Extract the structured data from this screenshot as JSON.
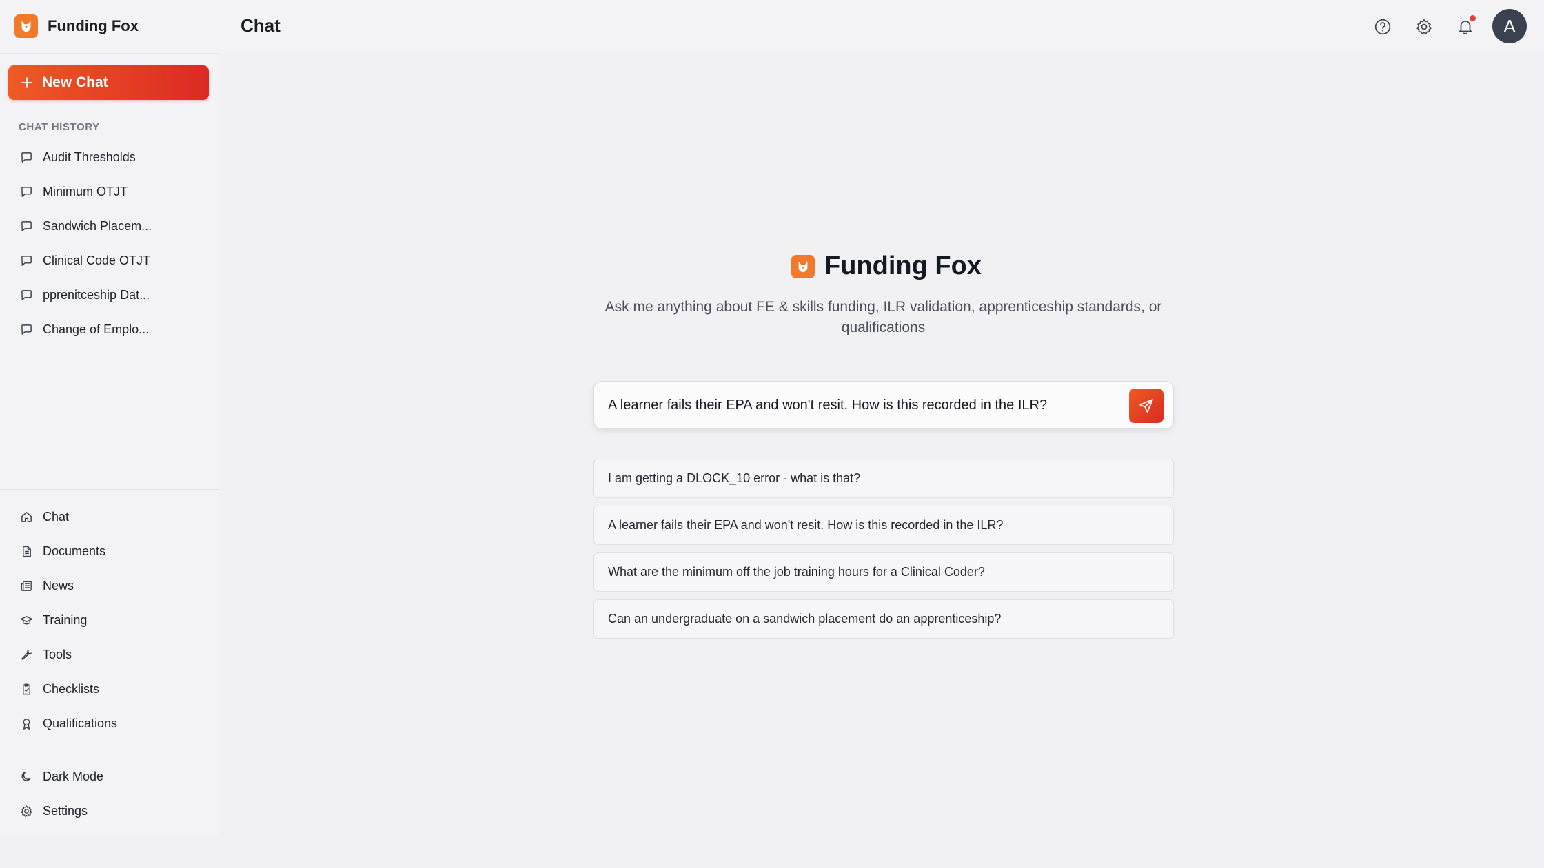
{
  "app": {
    "name": "Funding Fox",
    "logo_icon": "fox-logo-icon",
    "accent_color": "#e8431f"
  },
  "sidebar": {
    "new_chat_label": "New Chat",
    "history_label": "CHAT HISTORY",
    "history": [
      {
        "label": "Audit Thresholds",
        "icon": "message-icon"
      },
      {
        "label": "Minimum OTJT",
        "icon": "message-icon"
      },
      {
        "label": "Sandwich Placem...",
        "icon": "message-icon"
      },
      {
        "label": "Clinical Code OTJT",
        "icon": "message-icon"
      },
      {
        "label": "pprenitceship Dat...",
        "icon": "message-icon"
      },
      {
        "label": "Change of Emplo...",
        "icon": "message-icon"
      }
    ],
    "nav": [
      {
        "label": "Chat",
        "icon": "home-icon"
      },
      {
        "label": "Documents",
        "icon": "document-icon"
      },
      {
        "label": "News",
        "icon": "newspaper-icon"
      },
      {
        "label": "Training",
        "icon": "graduation-cap-icon"
      },
      {
        "label": "Tools",
        "icon": "wrench-icon"
      },
      {
        "label": "Checklists",
        "icon": "clipboard-check-icon"
      },
      {
        "label": "Qualifications",
        "icon": "award-icon"
      }
    ],
    "bottom": [
      {
        "label": "Dark Mode",
        "icon": "moon-icon"
      },
      {
        "label": "Settings",
        "icon": "gear-icon"
      }
    ]
  },
  "header": {
    "title": "Chat",
    "avatar_initial": "A",
    "icons": [
      "help-icon",
      "gear-icon",
      "bell-icon"
    ]
  },
  "main": {
    "hero_title": "Funding Fox",
    "hero_subtitle": "Ask me anything about FE & skills funding, ILR validation, apprenticeship standards, or qualifications",
    "input_value": "A learner fails their EPA and won't resit. How is this recorded in the ILR?",
    "suggestions": [
      "I am getting a DLOCK_10 error - what is that?",
      "A learner fails their EPA and won't resit. How is this recorded in the ILR?",
      "What are the minimum off the job training hours for a Clinical Coder?",
      "Can an undergraduate on a sandwich placement do an apprenticeship?"
    ]
  }
}
